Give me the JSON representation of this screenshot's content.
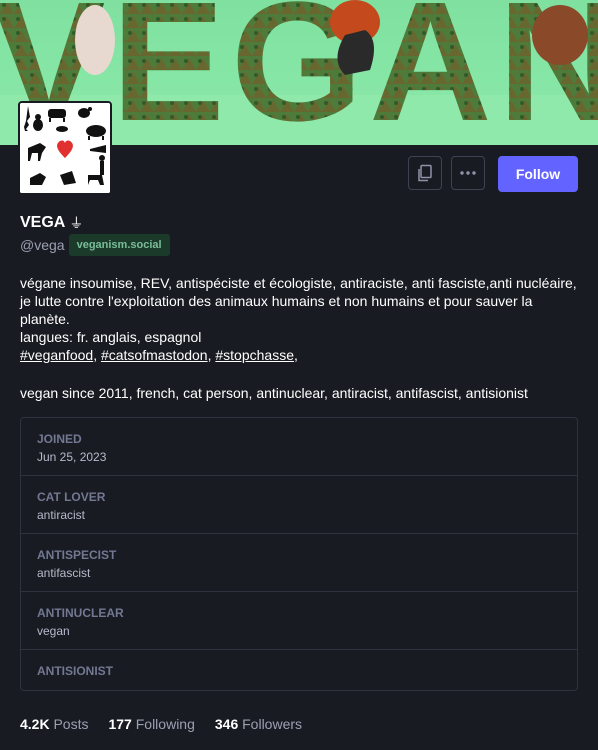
{
  "banner": {
    "text": "VEGAN"
  },
  "profile": {
    "display_name": "VEGA",
    "bot_glyph": "⏚",
    "handle": "@vega",
    "domain": "veganism.social"
  },
  "actions": {
    "copy_icon": "copy-icon",
    "more_icon": "ellipsis-icon",
    "follow_label": "Follow"
  },
  "bio": {
    "line1": "végane insoumise, REV, antispéciste et écologiste, antiraciste, anti fasciste,anti nucléaire, je lutte contre l'exploitation des animaux humains et non humains et pour sauver la planète.",
    "line2": "langues: fr. anglais, espagnol",
    "hashtags": [
      "#veganfood",
      "#catsofmastodon",
      "#stopchasse"
    ],
    "line3": "vegan since 2011, french, cat person, antinuclear, antiracist, antifascist, antisionist"
  },
  "fields": [
    {
      "name": "JOINED",
      "value": "Jun 25, 2023"
    },
    {
      "name": "CAT LOVER",
      "value": "antiracist"
    },
    {
      "name": "ANTISPECIST",
      "value": "antifascist"
    },
    {
      "name": "ANTINUCLEAR",
      "value": "vegan"
    },
    {
      "name": "ANTISIONIST",
      "value": ""
    }
  ],
  "counts": {
    "posts_value": "4.2K",
    "posts_label": "Posts",
    "following_value": "177",
    "following_label": "Following",
    "followers_value": "346",
    "followers_label": "Followers"
  },
  "colors": {
    "accent": "#6364ff",
    "background": "#191b22",
    "badge": "#79bd9a"
  }
}
